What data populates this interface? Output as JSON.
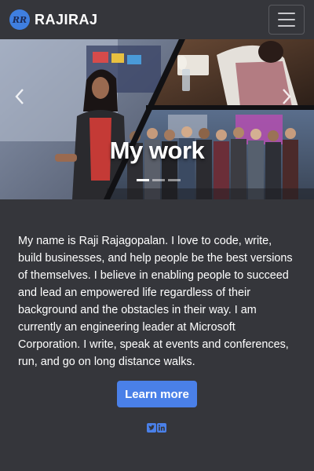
{
  "nav": {
    "logo_text": "RR",
    "brand": "RAJIRAJ"
  },
  "hero": {
    "title": "My work",
    "slide_count": 3,
    "active_slide": 1
  },
  "bio": {
    "text": "My name is Raji Rajagopalan. I love to code, write, build businesses, and help people be the best versions of themselves. I believe in enabling people to succeed and lead an empowered life regardless of their background and the obstacles in their way. I am currently an engineering leader at Microsoft Corporation. I write, speak at events and conferences, run, and go on long distance walks."
  },
  "cta": {
    "label": "Learn more"
  },
  "social": {
    "icons": [
      "twitter-icon",
      "linkedin-icon"
    ]
  },
  "colors": {
    "background": "#35363b",
    "accent": "#4a80e8",
    "text": "#ffffff"
  }
}
